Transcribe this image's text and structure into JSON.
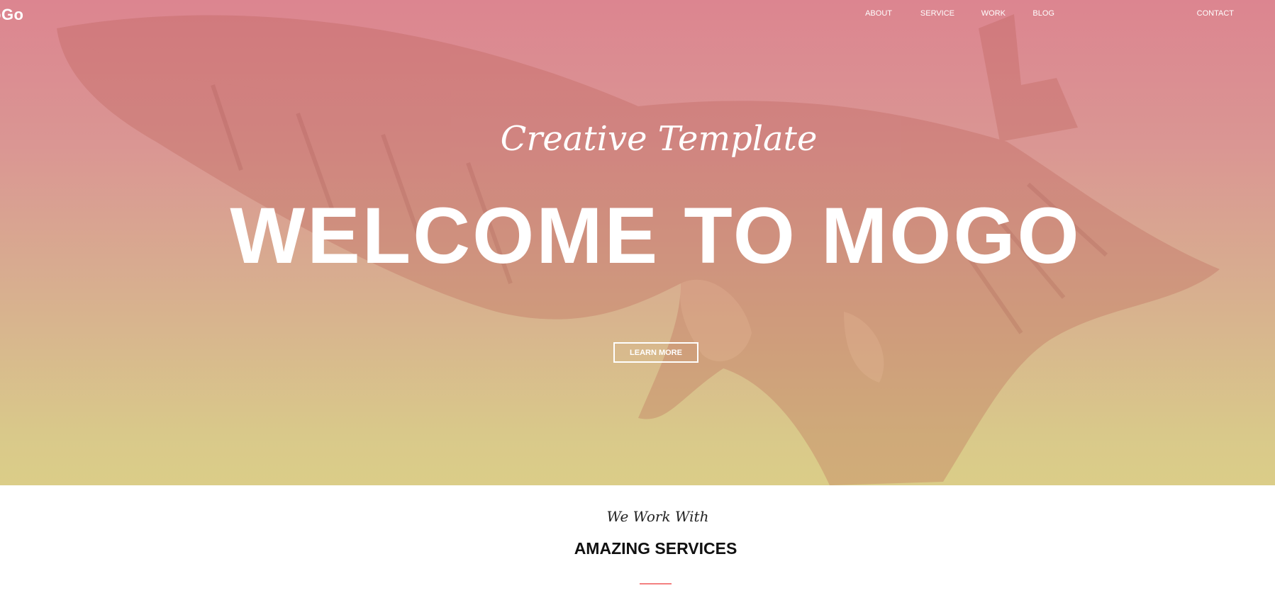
{
  "header": {
    "logo": "oGo",
    "nav": [
      {
        "label": "ABOUT"
      },
      {
        "label": "SERVICE"
      },
      {
        "label": "WORK"
      },
      {
        "label": "BLOG"
      },
      {
        "label": "CONTACT"
      }
    ]
  },
  "hero": {
    "subtitle": "Creative Template",
    "title": "WELCOME TO MOGO",
    "button_label": "LEARN MORE"
  },
  "services": {
    "subtitle": "We Work With",
    "title": "AMAZING SERVICES"
  },
  "colors": {
    "accent_line": "#f38181",
    "hero_top": "#dc8590",
    "hero_bottom": "#dbcd88"
  }
}
